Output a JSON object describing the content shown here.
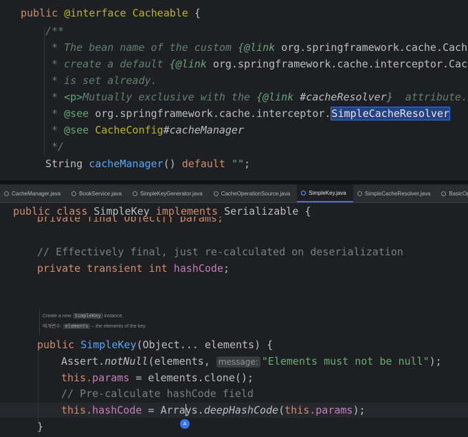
{
  "top_editor": {
    "l1": {
      "kw": "public ",
      "ann": "@interface ",
      "name": "Cacheable ",
      "brace": "{"
    },
    "l2": {
      "text": "/**"
    },
    "l3": {
      "prefix": " * The bean name of the custom ",
      "link": "{@link ",
      "ref": "org.springframework.cache.CacheM"
    },
    "l4": {
      "prefix": " * create a default ",
      "link": "{@link ",
      "ref": "org.springframework.cache.interceptor.Cache"
    },
    "l5": {
      "text": " * is set already."
    },
    "l6": {
      "prefix": " * ",
      "ptag": "<p>",
      "mid": "Mutually exclusive with the ",
      "link": "{@link ",
      "ref": "#cacheResolver",
      "close": "}",
      "suffix": "  attribute."
    },
    "l7": {
      "prefix": " * ",
      "tag": "@see ",
      "ref": "org.springframework.cache.interceptor.",
      "sel": "SimpleCacheResolver"
    },
    "l8": {
      "prefix": " * ",
      "tag": "@see ",
      "cls": "CacheConfig",
      "hash": "#",
      "member": "cacheManager"
    },
    "l9": {
      "text": " */"
    },
    "l10": {
      "type": "String ",
      "method": "cacheManager",
      "parens": "() ",
      "kw": "default ",
      "str": "\"\"",
      "end": ";"
    }
  },
  "tabs": [
    {
      "label": "CacheManager.java",
      "active": false
    },
    {
      "label": "BookService.java",
      "active": false
    },
    {
      "label": "SimpleKeyGenerator.java",
      "active": false
    },
    {
      "label": "CacheOperationSource.java",
      "active": false
    },
    {
      "label": "SimpleKey.java",
      "active": true
    },
    {
      "label": "SimpleCacheResolver.java",
      "active": false
    },
    {
      "label": "BasicOperation",
      "active": false
    }
  ],
  "bottom_editor": {
    "sticky": {
      "kw1": "public ",
      "kw2": "class ",
      "name": "SimpleKey ",
      "kw3": "implements ",
      "iface": "Serializable ",
      "brace": "{"
    },
    "cut": {
      "text": "private final Object[] params;"
    },
    "c1": {
      "text": "// Effectively final, just re-calculated on deserialization"
    },
    "f1": {
      "kw": "private transient int ",
      "field": "hashCode",
      "end": ";"
    },
    "doc": {
      "line1_prefix": "Create a new ",
      "line1_chip": "SimpleKey",
      "line1_suffix": " instance.",
      "line2_label": "매개변수: ",
      "line2_chip": "elements",
      "line2_suffix": " – the elements of the key"
    },
    "ctor": {
      "kw": "public ",
      "name": "SimpleKey",
      "args": "(Object... elements) {"
    },
    "a1": {
      "cls": "Assert.",
      "method": "notNull",
      "open": "(elements, ",
      "hint": "message:",
      "str": "\"Elements must not be null\"",
      "end": ");"
    },
    "a2": {
      "kw": "this.",
      "field": "params",
      "rest": " = elements.clone();"
    },
    "a3": {
      "text": "// Pre-calculate hashCode field"
    },
    "a4": {
      "kw": "this.",
      "field": "hashCode",
      "eq": " = ",
      "cls_a": "Array",
      "cls_b": "s.",
      "method": "deepHashCode",
      "open": "(",
      "kw2": "this.",
      "field2": "params",
      "end": ");"
    },
    "close": {
      "text": "}"
    },
    "badge": "A"
  }
}
